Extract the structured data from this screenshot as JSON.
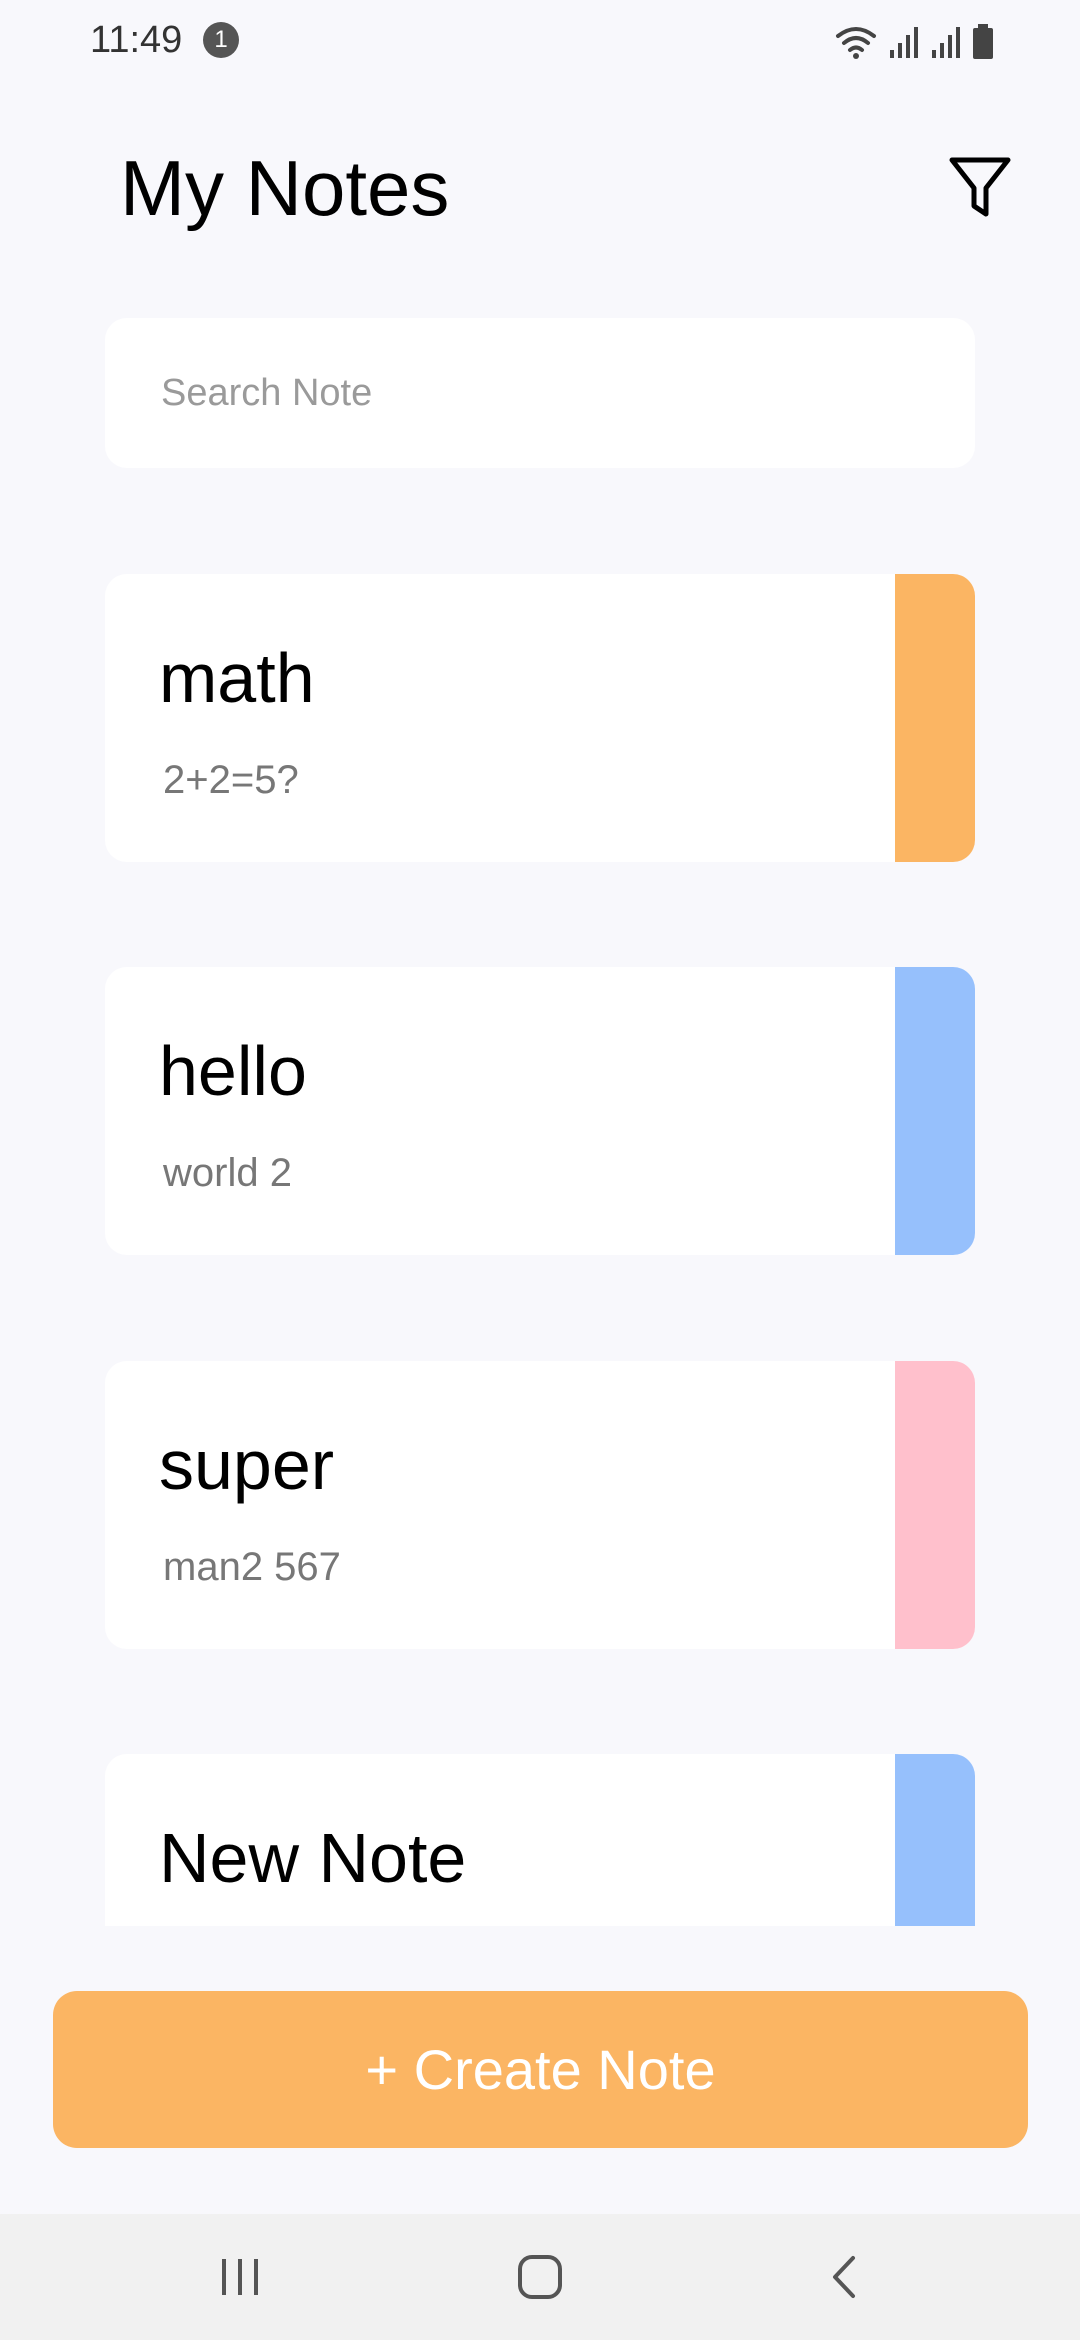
{
  "status_bar": {
    "time": "11:49",
    "notification_count": "1",
    "icons": [
      "wifi-icon",
      "signal-icon",
      "signal-icon",
      "battery-icon"
    ]
  },
  "header": {
    "title": "My Notes",
    "filter_icon": "filter-icon"
  },
  "search": {
    "placeholder": "Search Note",
    "value": ""
  },
  "notes": [
    {
      "title": "math",
      "body": "2+2=5?",
      "color": "#FBB563"
    },
    {
      "title": "hello",
      "body": "world 2",
      "color": "#96C0FC"
    },
    {
      "title": "super",
      "body": "man2 567",
      "color": "#FFC0CC"
    },
    {
      "title": "New Note",
      "body": "",
      "color": "#96C0FC"
    }
  ],
  "create_button": {
    "label": "+ Create Note",
    "color": "#FBB563"
  },
  "nav_bar": {
    "icons": [
      "recent-apps-icon",
      "home-icon",
      "back-icon"
    ]
  }
}
